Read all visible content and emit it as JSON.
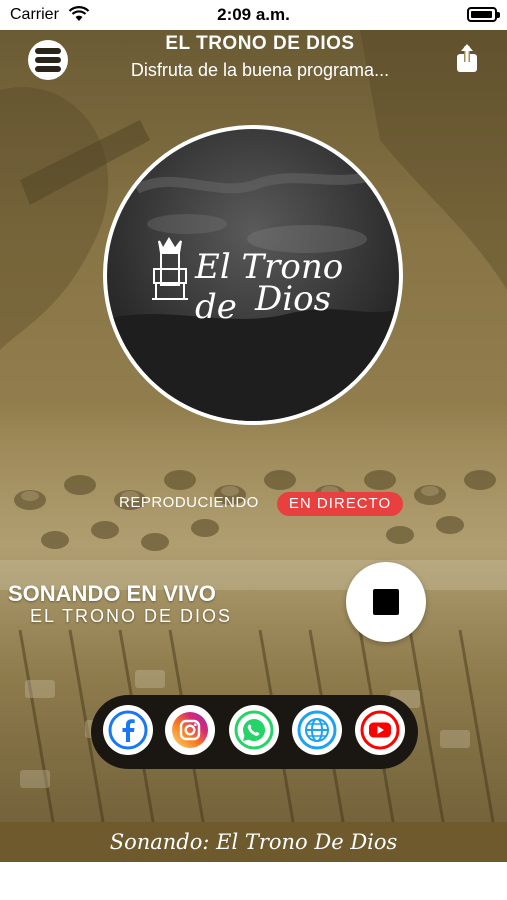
{
  "status_bar": {
    "carrier": "Carrier",
    "time": "2:09 a.m."
  },
  "header": {
    "title": "EL TRONO DE DIOS",
    "subtitle": "Disfruta de la buena programa...",
    "menu_icon": "hamburger-menu-icon",
    "share_icon": "share-icon"
  },
  "logo": {
    "line1": "El Trono de",
    "line2": "Dios"
  },
  "status": {
    "playing": "REPRODUCIENDO",
    "live": "EN DIRECTO",
    "live_color": "#e8403f"
  },
  "now_playing": {
    "title": "SONANDO EN VIVO",
    "station": "EL TRONO DE DIOS",
    "stop_icon": "stop-icon"
  },
  "social": [
    {
      "name": "facebook",
      "icon": "facebook-icon",
      "color": "#1877f2"
    },
    {
      "name": "instagram",
      "icon": "instagram-icon",
      "color": "#d6249f"
    },
    {
      "name": "whatsapp",
      "icon": "whatsapp-icon",
      "color": "#25d366"
    },
    {
      "name": "web",
      "icon": "globe-icon",
      "color": "#1da1f2"
    },
    {
      "name": "youtube",
      "icon": "youtube-icon",
      "color": "#ff0000"
    }
  ],
  "ticker": "Sonando: El Trono De Dios",
  "colors": {
    "accent": "#a38d55",
    "ticker_bg": "#6f5a2e",
    "social_bar": "#1a1713"
  }
}
